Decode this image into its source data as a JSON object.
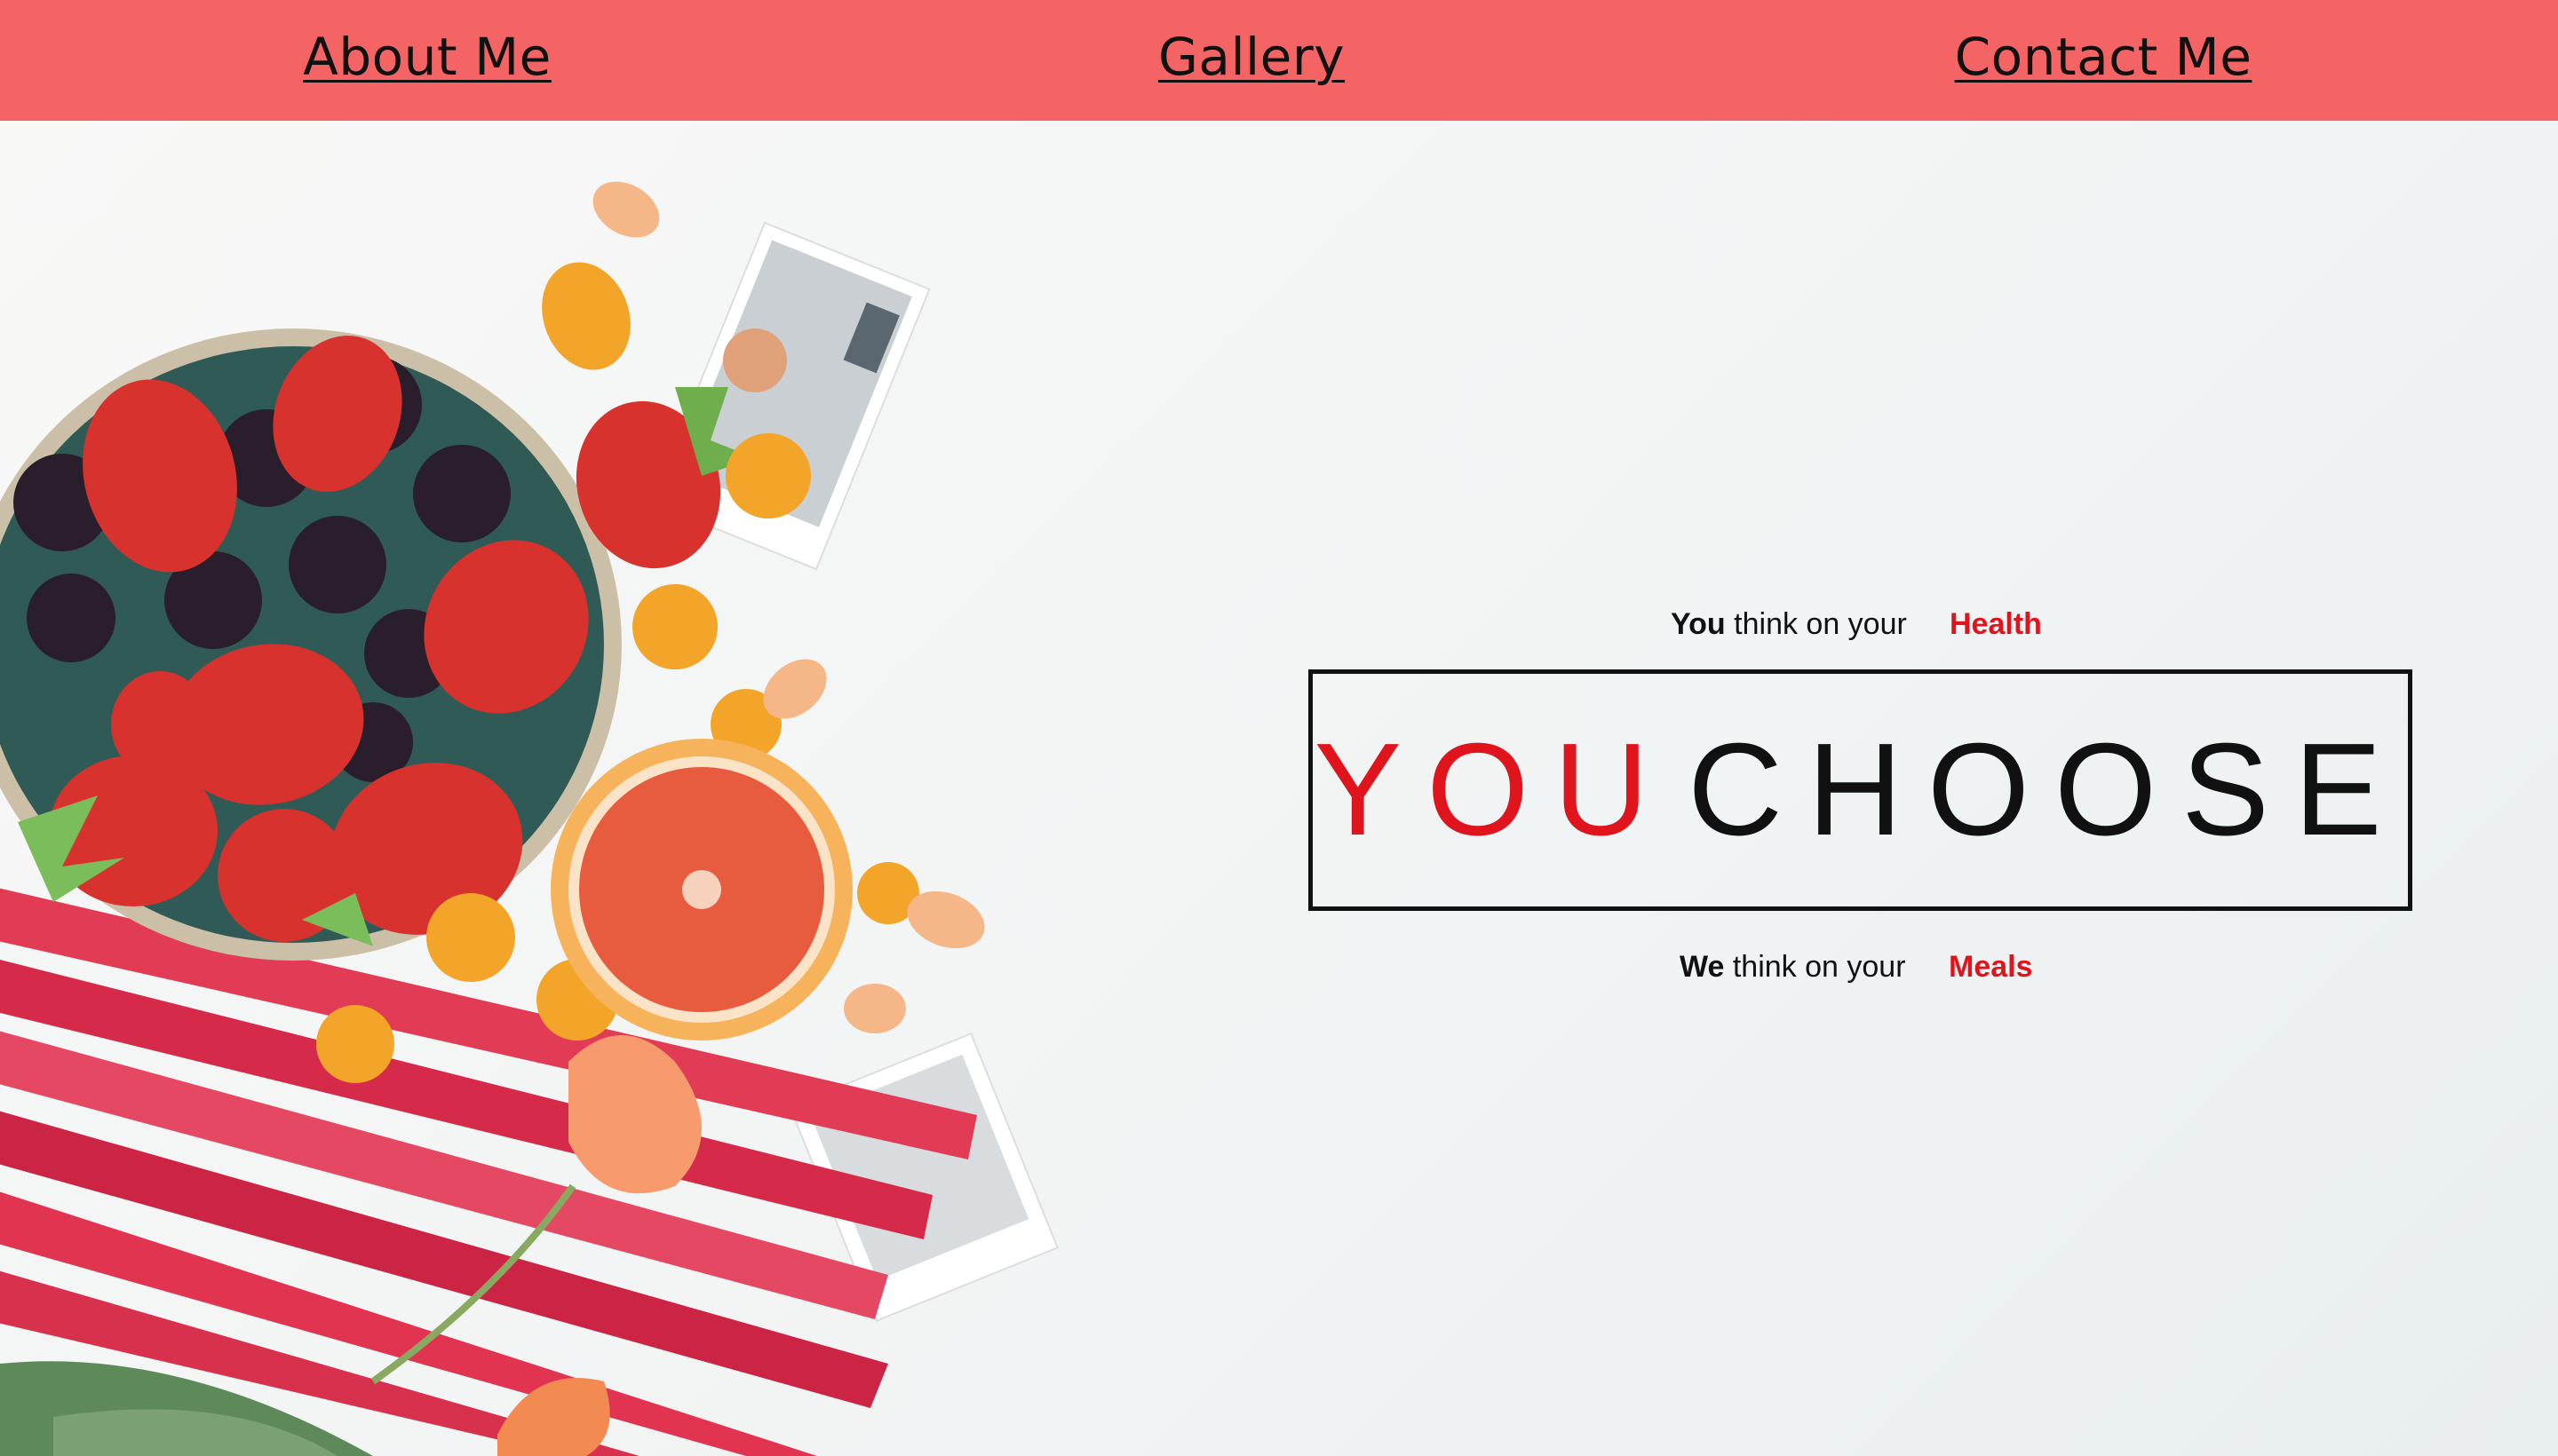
{
  "nav": {
    "items": [
      {
        "label": "About Me"
      },
      {
        "label": "Gallery"
      },
      {
        "label": "Contact Me"
      }
    ]
  },
  "hero": {
    "top_line": {
      "bold": "You",
      "text": "think on your",
      "accent": "Health"
    },
    "brand": {
      "part1": "YOU",
      "part2": "CHOOSE"
    },
    "bottom_line": {
      "bold": "We",
      "text": "think on your",
      "accent": "Meals"
    }
  },
  "colors": {
    "nav_bg": "#f56464",
    "accent_red": "#e0141d",
    "text": "#111111"
  }
}
